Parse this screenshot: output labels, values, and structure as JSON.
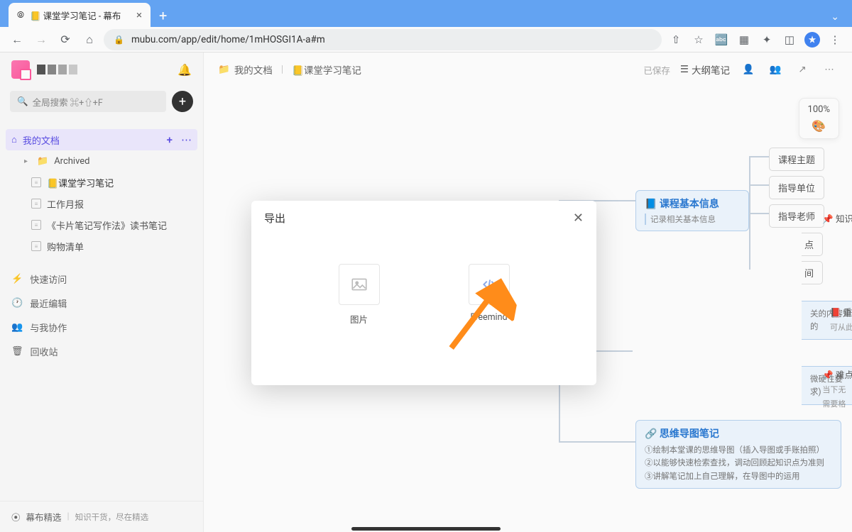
{
  "browser": {
    "tab_title": "📒 课堂学习笔记 - 幕布",
    "url": "mubu.com/app/edit/home/1mHOSGI1A-a#m"
  },
  "sidebar": {
    "search_placeholder": "全局搜索 ⌘+⇧+F",
    "root_label": "我的文档",
    "items": [
      {
        "label": "Archived",
        "type": "folder"
      },
      {
        "label": "📒课堂学习笔记",
        "type": "file",
        "active": true
      },
      {
        "label": "工作月报",
        "type": "file"
      },
      {
        "label": "《卡片笔记写作法》读书笔记",
        "type": "file"
      },
      {
        "label": "购物清单",
        "type": "file"
      }
    ],
    "utils": [
      {
        "icon": "⚡",
        "label": "快速访问"
      },
      {
        "icon": "🕐",
        "label": "最近编辑"
      },
      {
        "icon": "👥",
        "label": "与我协作"
      },
      {
        "icon": "🗑",
        "label": "回收站"
      }
    ],
    "footer_left": "幕布精选",
    "footer_right": "知识干货，尽在精选"
  },
  "topbar": {
    "crumb_root": "我的文档",
    "crumb_doc": "📒课堂学习笔记",
    "saved": "已保存",
    "outline": "大纲笔记"
  },
  "zoom": {
    "level": "100%"
  },
  "mindmap": {
    "box1_title": "📘 课程基本信息",
    "box1_sub": "记录相关基本信息",
    "leaves": [
      "课程主题",
      "指导单位",
      "指导老师"
    ],
    "partial_leaf1": "点",
    "partial_leaf2": "间",
    "box2_body": "关的内容知识点，并将其作一个简单标签式的",
    "box3_body": "微硬性要求)",
    "box4_title": "🔗 思维导图笔记",
    "box4_line1": "①绘制本堂课的思维导图（插入导图或手账拍照）",
    "box4_line2": "②以能够快速检索查找，调动回顾起知识点为准则",
    "box4_line3": "③讲解笔记加上自己理解，在导图中的运用",
    "right1": "📌 知识",
    "right2_title": "📕 重",
    "right2_sub": "可从此",
    "right3_title": "📌 难点",
    "right3_sub1": "当下无",
    "right3_sub2": "需要格"
  },
  "modal": {
    "title": "导出",
    "opt1": "图片",
    "opt2": "Freemind"
  }
}
